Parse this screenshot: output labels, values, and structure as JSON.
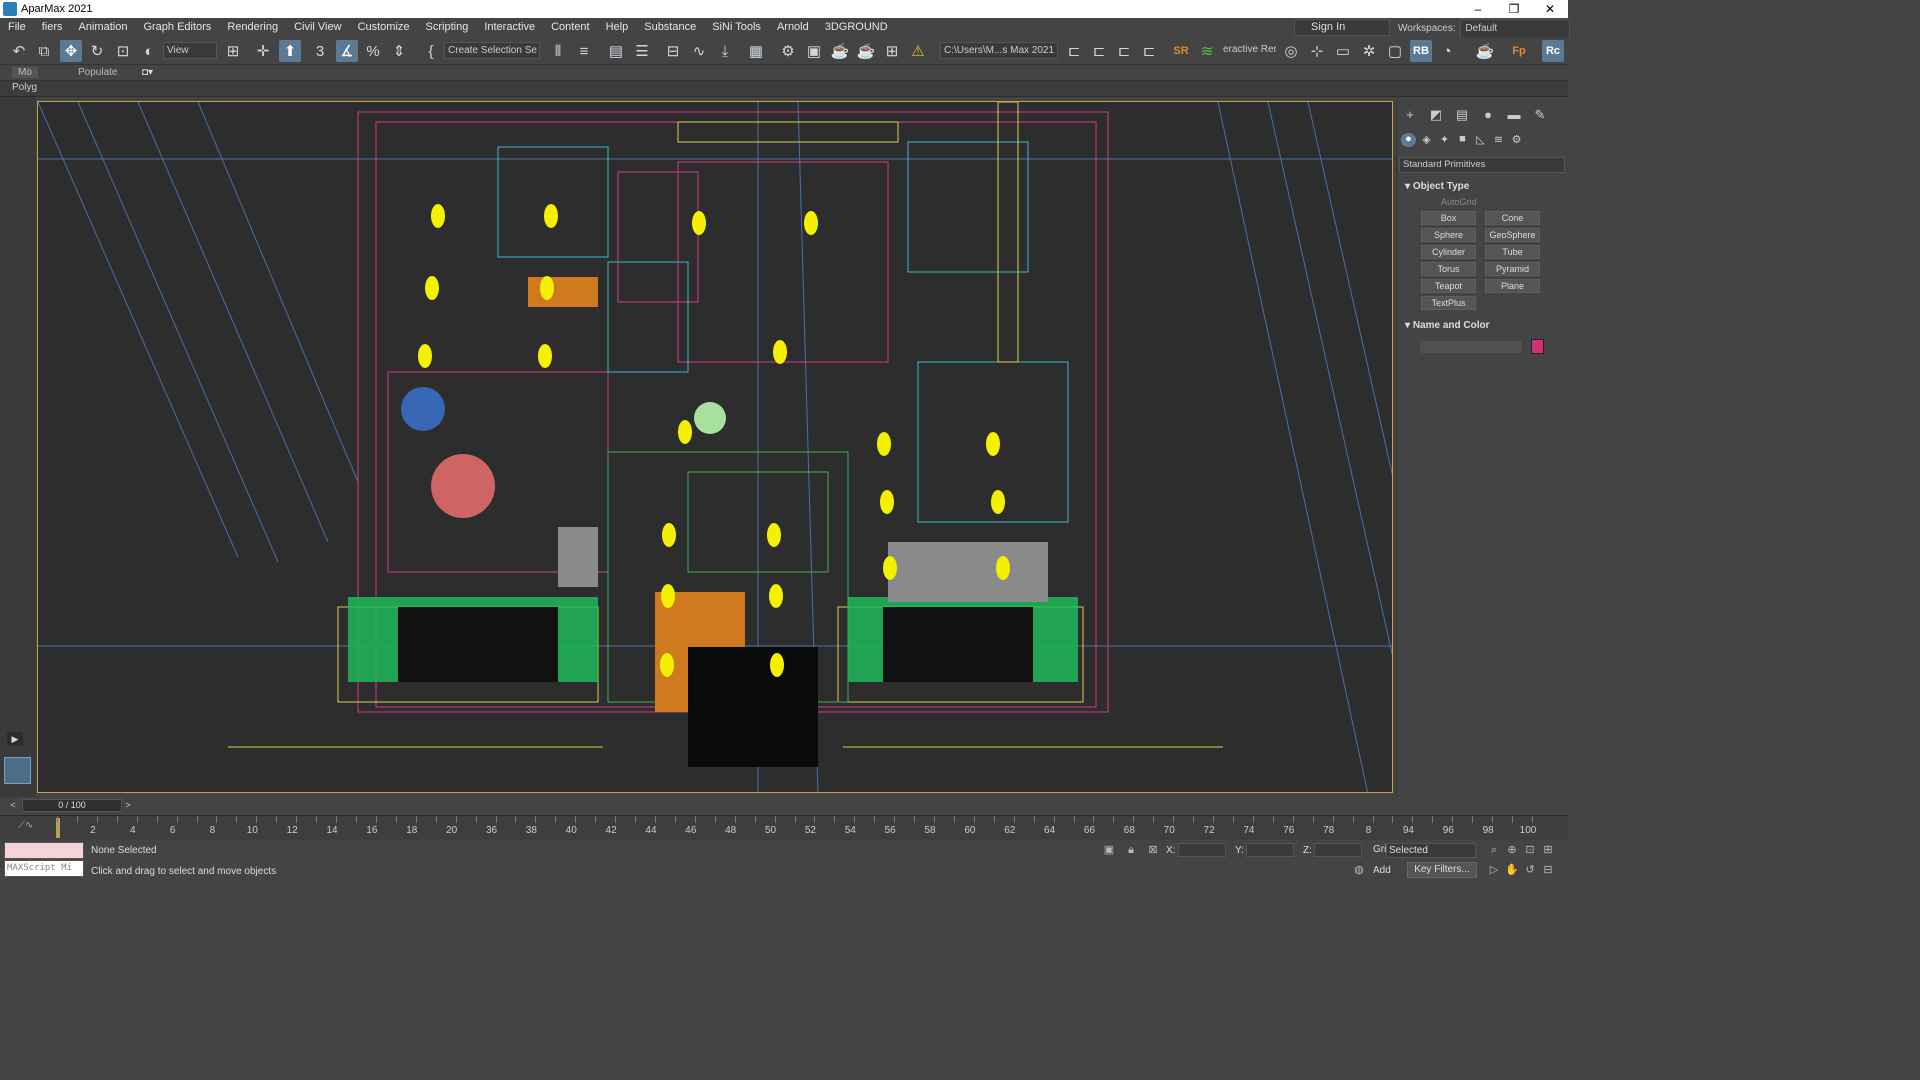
{
  "app": {
    "title": "AparMax 2021"
  },
  "window_controls": {
    "minimize": "–",
    "restore": "❐",
    "close": "✕"
  },
  "menu": [
    "File",
    "fiers",
    "Animation",
    "Graph Editors",
    "Rendering",
    "Civil View",
    "Customize",
    "Scripting",
    "Interactive",
    "Content",
    "Help",
    "Substance",
    "SiNi Tools",
    "Arnold",
    "3DGROUND"
  ],
  "signin": {
    "label": "Sign In"
  },
  "workspace": {
    "label": "Workspaces:",
    "value": "Default"
  },
  "toolbar": {
    "view_combo": "View",
    "selection_set": "Create Selection Se",
    "project_path": "C:\\Users\\M...s Max 2021",
    "render_label": "eractive Rena"
  },
  "ribbon": {
    "tab_modeling": "Mo",
    "tab_populate": "Populate"
  },
  "polygon_label": "Polyg",
  "command_panel": {
    "dropdown": "Standard Primitives",
    "object_type_title": "Object Type",
    "autogrid": "AutoGrid",
    "primitives": [
      "Box",
      "Cone",
      "Sphere",
      "GeoSphere",
      "Cylinder",
      "Tube",
      "Torus",
      "Pyramid",
      "Teapot",
      "Plane",
      "TextPlus"
    ],
    "name_color_title": "Name and Color",
    "object_color": "#d4307a"
  },
  "timeline": {
    "frame_display": "0 / 100",
    "ticks": [
      "2",
      "4",
      "6",
      "8",
      "10",
      "12",
      "14",
      "16",
      "18",
      "20",
      "36",
      "38",
      "40",
      "42",
      "44",
      "46",
      "48",
      "50",
      "52",
      "54",
      "56",
      "58",
      "60",
      "62",
      "64",
      "66",
      "68",
      "70",
      "72",
      "74",
      "76",
      "78",
      "8",
      "94",
      "96",
      "98",
      "100"
    ]
  },
  "status": {
    "selection": "None Selected",
    "prompt": "Click and drag to select and move objects",
    "maxscript": "MAXScript Mi",
    "x_label": "X:",
    "y_label": "Y:",
    "z_label": "Z:",
    "grid_label": "Grid",
    "selected_set": "Selected",
    "add_key": "Add",
    "key_filters": "Key Filters..."
  },
  "colors": {
    "viewport_border": "#c8a24a",
    "active_tool": "#5b7a96",
    "background": "#444444",
    "viewport": "#2d2d2d"
  }
}
